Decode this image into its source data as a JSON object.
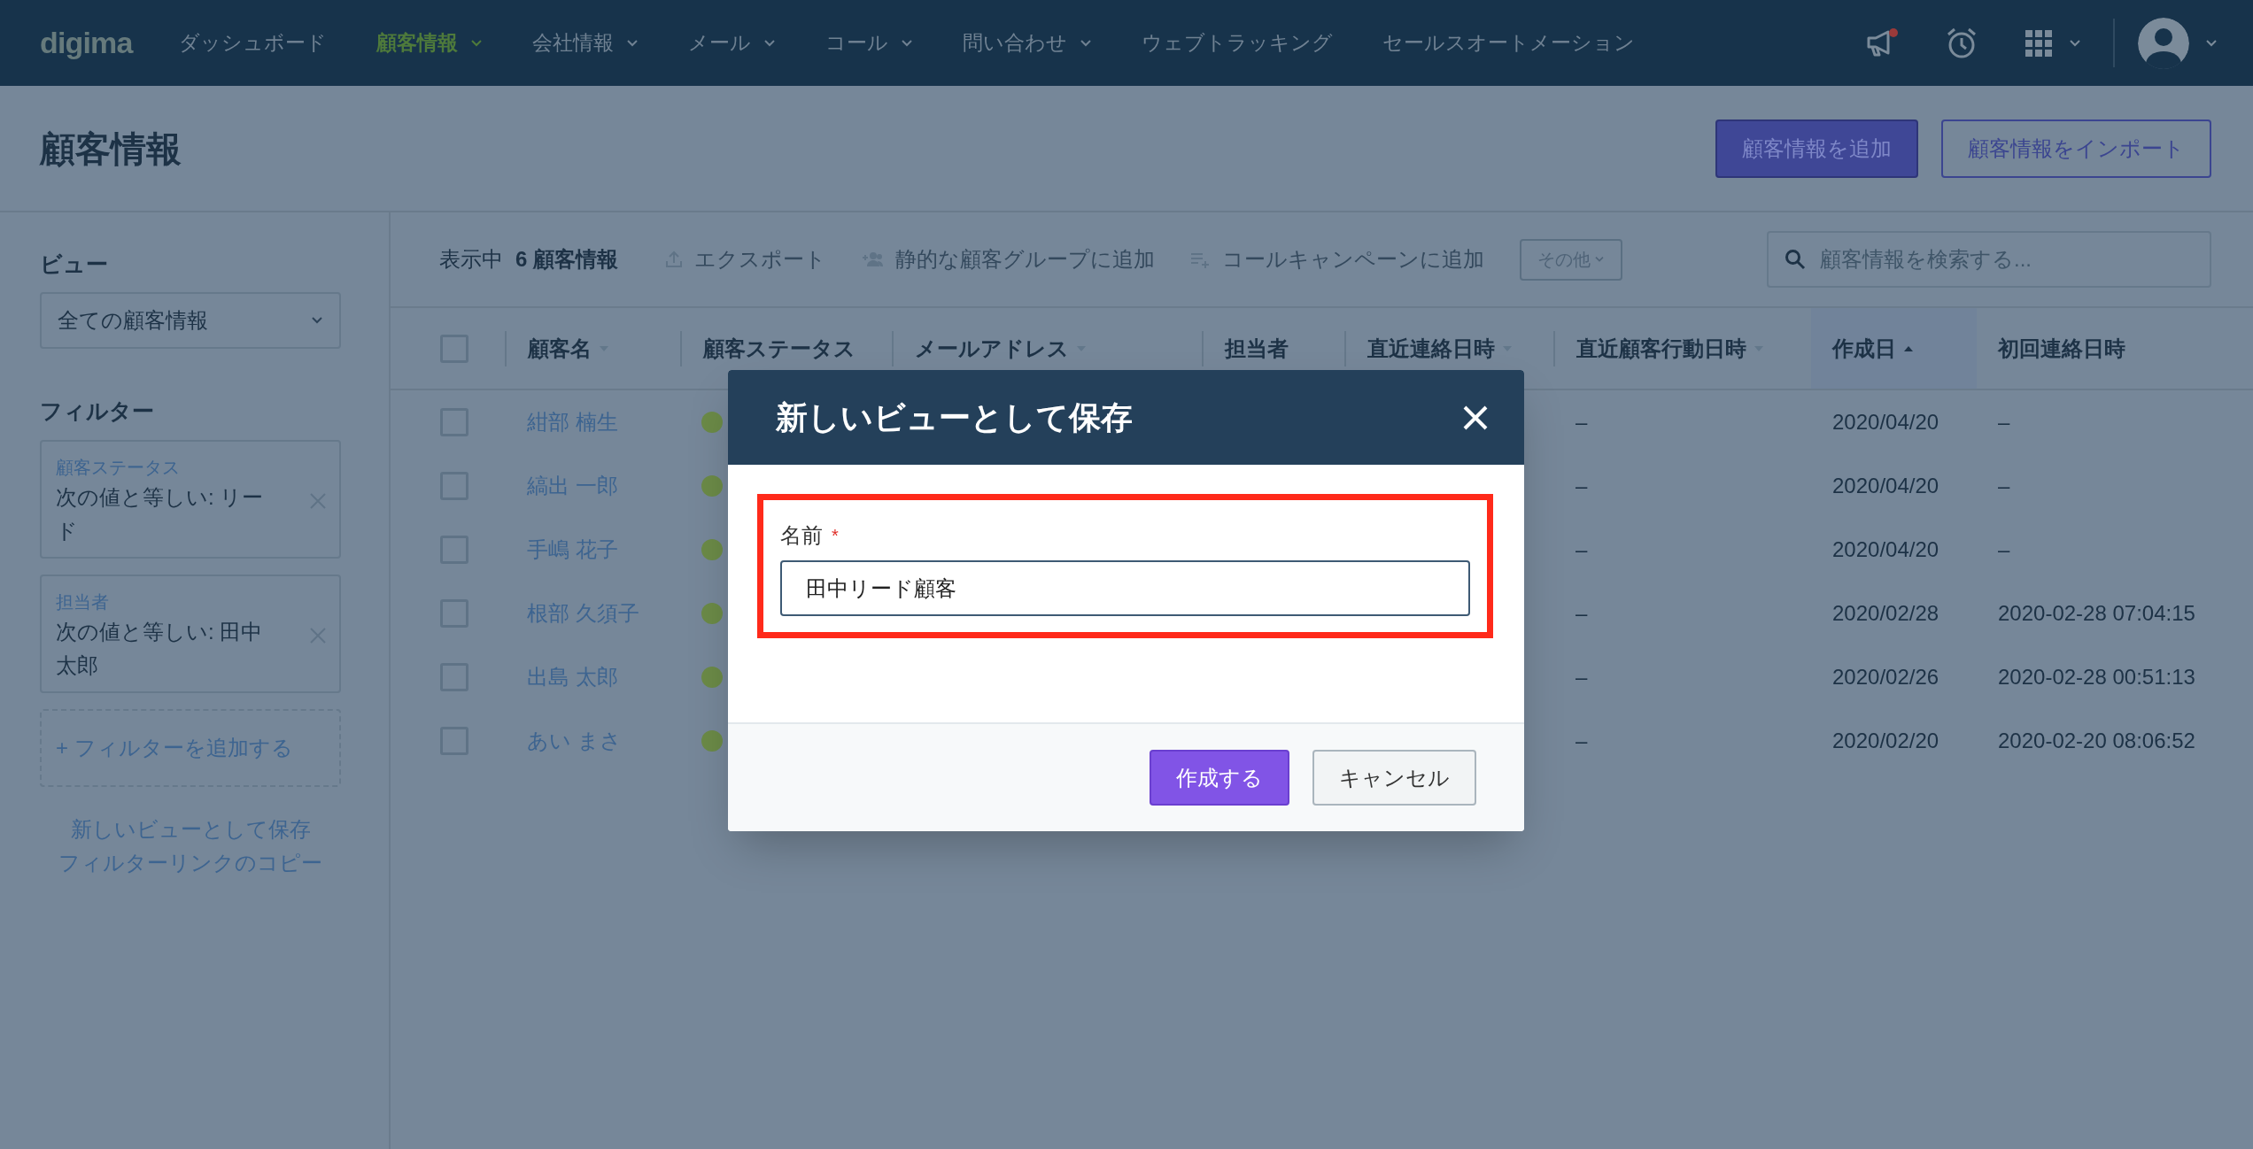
{
  "nav": {
    "logo": "digima",
    "items": [
      {
        "label": "ダッシュボード",
        "selected": false,
        "has_menu": false
      },
      {
        "label": "顧客情報",
        "selected": true,
        "has_menu": true
      },
      {
        "label": "会社情報",
        "selected": false,
        "has_menu": true
      },
      {
        "label": "メール",
        "selected": false,
        "has_menu": true
      },
      {
        "label": "コール",
        "selected": false,
        "has_menu": true
      },
      {
        "label": "問い合わせ",
        "selected": false,
        "has_menu": true
      },
      {
        "label": "ウェブトラッキング",
        "selected": false,
        "has_menu": false
      },
      {
        "label": "セールスオートメーション",
        "selected": false,
        "has_menu": false
      }
    ],
    "notification_badge": true
  },
  "page_title": "顧客情報",
  "header_buttons": [
    {
      "label": "顧客情報を追加",
      "kind": "primary"
    },
    {
      "label": "顧客情報をインポート",
      "kind": "outline"
    }
  ],
  "sidebar": {
    "view_label": "ビュー",
    "view_select": {
      "value": "全ての顧客情報"
    },
    "filters_label": "フィルター",
    "filters": [
      {
        "field": "顧客ステータス",
        "condition": "次の値と等しい: リード"
      },
      {
        "field": "担当者",
        "condition": "次の値と等しい: 田中太郎"
      }
    ],
    "add_filter": "+ フィルターを追加する",
    "links": [
      "新しいビューとして保存",
      "フィルターリンクのコピー"
    ]
  },
  "toolbar": {
    "count_prefix": "表示中",
    "count": "6 顧客情報",
    "actions": [
      {
        "label": "エクスポート",
        "kind": "export"
      },
      {
        "label": "静的な顧客グループに追加",
        "kind": "group"
      },
      {
        "label": "コールキャンペーンに追加",
        "kind": "call"
      }
    ],
    "more_button": "その他",
    "search": {
      "placeholder": "顧客情報を検索する..."
    }
  },
  "table": {
    "select_all_checked": false,
    "columns": [
      {
        "label": "顧客名",
        "sortable": true,
        "sorted": false
      },
      {
        "label": "顧客ステータス",
        "sortable": false,
        "sorted": false
      },
      {
        "label": "メールアドレス",
        "sortable": true,
        "sorted": false
      },
      {
        "label": "担当者",
        "sortable": false,
        "sorted": false
      },
      {
        "label": "直近連絡日時",
        "sortable": true,
        "sorted": false
      },
      {
        "label": "直近顧客行動日時",
        "sortable": true,
        "sorted": false
      },
      {
        "label": "作成日",
        "sortable": true,
        "sorted": true
      },
      {
        "label": "初回連絡日時",
        "sortable": false,
        "sorted": false
      }
    ],
    "rows": [
      {
        "checked": false,
        "name": "紺部 楠生",
        "color": "#6b8a47",
        "last_action": "–",
        "created": "2020/04/20",
        "first_contact": "–"
      },
      {
        "checked": false,
        "name": "縞出 一郎",
        "color": "#6b8a47",
        "last_action": "–",
        "created": "2020/04/20",
        "first_contact": "–"
      },
      {
        "checked": false,
        "name": "手嶋 花子",
        "color": "#6b8a47",
        "last_action": "–",
        "created": "2020/04/20",
        "first_contact": "–"
      },
      {
        "checked": false,
        "name": "根部 久須子",
        "color": "#6b8a47",
        "last_action": "–",
        "created": "2020/02/28",
        "first_contact": "2020-02-28 07:04:15"
      },
      {
        "checked": false,
        "name": "出島 太郎",
        "color": "#6b8a47",
        "last_action": "–",
        "created": "2020/02/26",
        "first_contact": "2020-02-28 00:51:13"
      },
      {
        "checked": false,
        "name": "あい まさ",
        "color": "#6b8a47",
        "last_action": "–",
        "created": "2020/02/20",
        "first_contact": "2020-02-20 08:06:52"
      }
    ]
  },
  "dialog": {
    "title": "新しいビューとして保存",
    "field": {
      "label": "名前",
      "required_mark": "*",
      "value": "田中リード顧客",
      "highlighted": true
    },
    "buttons": [
      {
        "label": "作成する",
        "kind": "primary"
      },
      {
        "label": "キャンセル",
        "kind": "secondary"
      }
    ]
  }
}
